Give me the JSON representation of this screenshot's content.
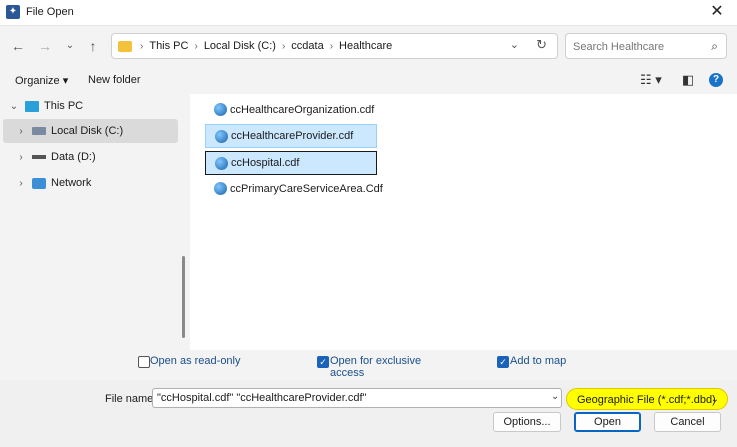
{
  "window": {
    "title": "File Open"
  },
  "address": {
    "crumbs": [
      "This PC",
      "Local Disk (C:)",
      "ccdata",
      "Healthcare"
    ]
  },
  "search": {
    "placeholder": "Search Healthcare"
  },
  "toolbar": {
    "organize": "Organize ▾",
    "new_folder": "New folder"
  },
  "nav_tree": [
    {
      "label": "This PC",
      "icon": "pc-icon",
      "expanded": true
    },
    {
      "label": "Local Disk (C:)",
      "icon": "disk-icon",
      "selected": true
    },
    {
      "label": "Data (D:)",
      "icon": "drive-icon"
    },
    {
      "label": "Network",
      "icon": "network-icon"
    }
  ],
  "files": [
    {
      "name": "ccHealthcareOrganization.cdf",
      "selected": false
    },
    {
      "name": "ccHealthcareProvider.cdf",
      "selected": true
    },
    {
      "name": "ccHospital.cdf",
      "selected": true,
      "focused": true
    },
    {
      "name": "ccPrimaryCareServiceArea.Cdf",
      "selected": false
    }
  ],
  "options": {
    "read_only": {
      "label": "Open as read-only",
      "checked": false
    },
    "exclusive": {
      "label_line1": "Open for exclusive",
      "label_line2": "access",
      "checked": true
    },
    "add_to_map": {
      "label": "Add to map",
      "checked": true
    }
  },
  "bottom": {
    "file_name_label": "File name:",
    "file_name_value": "\"ccHospital.cdf\" \"ccHealthcareProvider.cdf\"",
    "filter": "Geographic File (*.cdf;*.dbd)",
    "options_button": "Options...",
    "open_button": "Open",
    "cancel_button": "Cancel"
  },
  "colors": {
    "highlight_yellow": "#ffff00",
    "selection_blue": "#cce8ff",
    "accent": "#1a63b8"
  }
}
